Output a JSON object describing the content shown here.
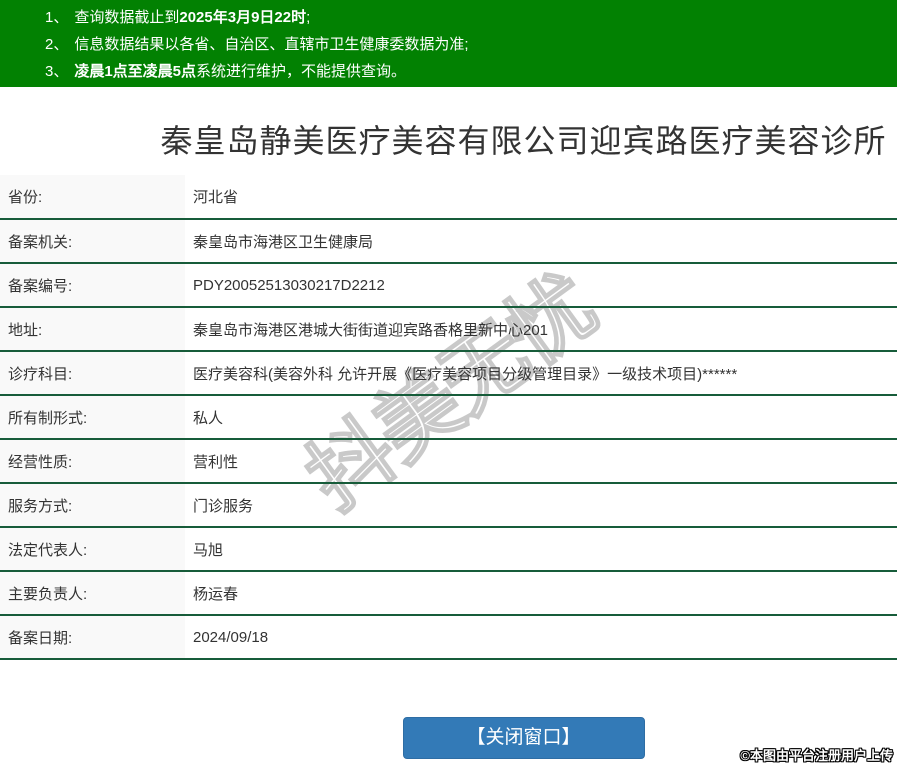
{
  "colors": {
    "header_green": "#028102",
    "separator_green": "#175c3a",
    "label_bg": "#f9f9f9",
    "button_blue": "#337ab7",
    "text": "#333333"
  },
  "notices": {
    "items": [
      {
        "num": "1、",
        "pre": "查询数据截止到",
        "bold": "2025年3月9日22时",
        "post": ";"
      },
      {
        "num": "2、",
        "pre": "信息数据结果以各省、自治区、直辖市卫生健康委数据为准;",
        "bold": "",
        "post": ""
      },
      {
        "num": "3、",
        "pre": "",
        "bold": "凌晨1点至凌晨5点",
        "post": "系统进行维护，不能提供查询。"
      }
    ]
  },
  "title": "秦皇岛静美医疗美容有限公司迎宾路医疗美容诊所",
  "table": {
    "rows": [
      {
        "label": "省份:",
        "value": "河北省"
      },
      {
        "label": "备案机关:",
        "value": "秦皇岛市海港区卫生健康局"
      },
      {
        "label": "备案编号:",
        "value": "PDY20052513030217D2212"
      },
      {
        "label": "地址:",
        "value": "秦皇岛市海港区港城大街街道迎宾路香格里新中心201"
      },
      {
        "label": "诊疗科目:",
        "value": "医疗美容科(美容外科 允许开展《医疗美容项目分级管理目录》一级技术项目)******"
      },
      {
        "label": "所有制形式:",
        "value": "私人"
      },
      {
        "label": "经营性质:",
        "value": "营利性"
      },
      {
        "label": "服务方式:",
        "value": "门诊服务"
      },
      {
        "label": "法定代表人:",
        "value": "马旭"
      },
      {
        "label": "主要负责人:",
        "value": "杨运春"
      },
      {
        "label": "备案日期:",
        "value": "2024/09/18"
      }
    ]
  },
  "button": {
    "label": "【关闭窗口】"
  },
  "watermark": {
    "text": "抖美无忧"
  },
  "footer": {
    "credit": "©本图由平台注册用户上传"
  }
}
